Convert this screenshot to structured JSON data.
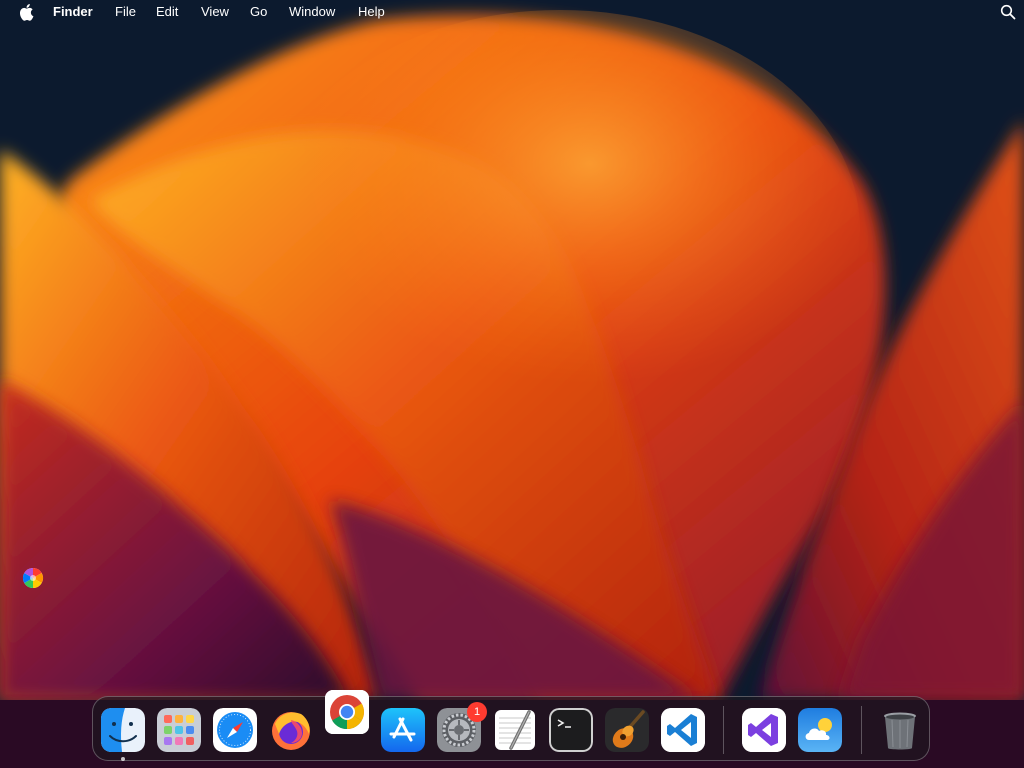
{
  "menubar": {
    "app_name": "Finder",
    "menus": [
      "File",
      "Edit",
      "View",
      "Go",
      "Window",
      "Help"
    ],
    "icons": {
      "apple": "apple-logo-icon",
      "search": "spotlight-search-icon"
    }
  },
  "desktop": {
    "widget_icon": "color-wheel-icon"
  },
  "dock": {
    "items": [
      {
        "id": "finder",
        "icon": "finder-icon"
      },
      {
        "id": "launchpad",
        "icon": "launchpad-icon"
      },
      {
        "id": "safari",
        "icon": "safari-icon"
      },
      {
        "id": "firefox",
        "icon": "firefox-icon"
      },
      {
        "id": "chrome",
        "icon": "chrome-icon"
      },
      {
        "id": "app-store",
        "icon": "app-store-icon"
      },
      {
        "id": "system-settings",
        "icon": "gear-icon",
        "badge": "1"
      },
      {
        "id": "textedit",
        "icon": "textedit-icon"
      },
      {
        "id": "terminal",
        "icon": "terminal-icon"
      },
      {
        "id": "garageband",
        "icon": "garageband-icon"
      },
      {
        "id": "vscode",
        "icon": "vscode-icon"
      },
      {
        "id": "visual-studio",
        "icon": "visual-studio-icon"
      },
      {
        "id": "weather",
        "icon": "weather-icon"
      },
      {
        "id": "trash",
        "icon": "trash-icon"
      }
    ]
  },
  "colors": {
    "dock_background": "#1c181e",
    "badge": "#ff3b30",
    "wallpaper_dark": "#0c1a2e",
    "wallpaper_orange": "#f26a10",
    "wallpaper_magenta": "#5a1040"
  }
}
